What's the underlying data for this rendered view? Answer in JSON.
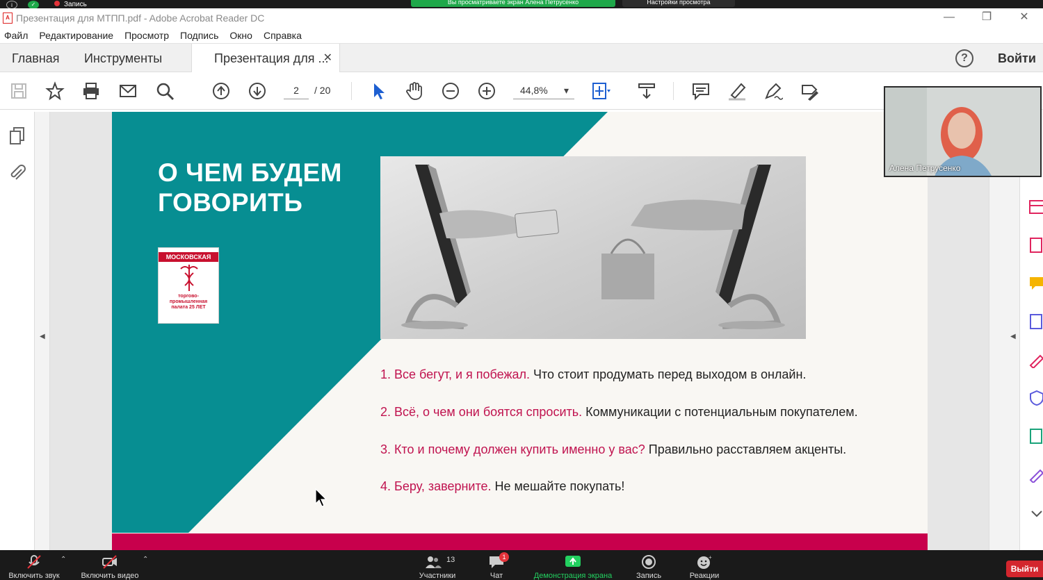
{
  "zoom_top": {
    "recording_label": "Запись",
    "share_banner": "Вы просматриваете экран Алена Петрусенко",
    "view_settings": "Настройки просмотра"
  },
  "window": {
    "title": "Презентация для МТПП.pdf - Adobe Acrobat Reader DC"
  },
  "menu": [
    "Файл",
    "Редактирование",
    "Просмотр",
    "Подпись",
    "Окно",
    "Справка"
  ],
  "tabs": {
    "home": "Главная",
    "tools": "Инструменты",
    "document": "Презентация для ..."
  },
  "account": {
    "login": "Войти"
  },
  "toolbar": {
    "page_current": "2",
    "page_total": "/  20",
    "zoom": "44,8%"
  },
  "slide": {
    "title": "О ЧЕМ БУДЕМ ГОВОРИТЬ",
    "logo_top": "МОСКОВСКАЯ",
    "logo_bottom": "торгово-промышленная палата 25 ЛЕТ",
    "bullets": [
      {
        "accent": "1. Все бегут, и я побежал.",
        "text": " Что стоит продумать перед выходом в онлайн."
      },
      {
        "accent": "2. Всё, о чем они боятся спросить.",
        "text": " Коммуникации с потенциальным покупателем."
      },
      {
        "accent": "3. Кто и почему должен купить именно у вас?",
        "text": " Правильно расставляем акценты."
      },
      {
        "accent": "4. Беру, заверните.",
        "text": " Не мешайте покупать!"
      }
    ],
    "colors": {
      "teal": "#078e92",
      "accent": "#c0134f",
      "footer": "#c8004c",
      "background": "#f9f7f3"
    }
  },
  "participant": {
    "name": "Алена Петрусенко"
  },
  "zoom_bottom": {
    "audio": "Включить звук",
    "video": "Включить видео",
    "participants": "Участники",
    "participants_count": "13",
    "chat": "Чат",
    "chat_badge": "1",
    "share": "Демонстрация экрана",
    "record": "Запись",
    "reactions": "Реакции",
    "exit": "Выйти"
  }
}
